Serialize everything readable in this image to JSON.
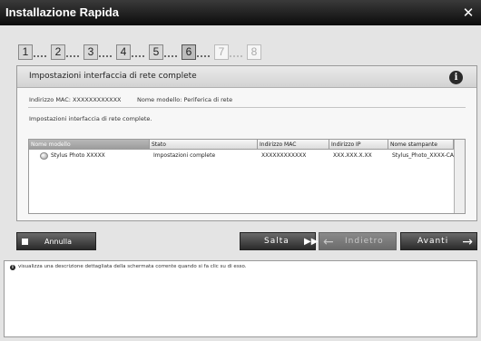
{
  "window": {
    "title": "Installazione Rapida",
    "close_icon": "close-icon"
  },
  "steps": [
    {
      "label": "1",
      "state": "done"
    },
    {
      "label": "2",
      "state": "done"
    },
    {
      "label": "3",
      "state": "done"
    },
    {
      "label": "4",
      "state": "done"
    },
    {
      "label": "5",
      "state": "done"
    },
    {
      "label": "6",
      "state": "current"
    },
    {
      "label": "7",
      "state": "disabled"
    },
    {
      "label": "8",
      "state": "disabled"
    }
  ],
  "panel": {
    "heading": "Impostazioni interfaccia di rete complete",
    "info_icon": "info-icon",
    "mac_label": "Indirizzo MAC: XXXXXXXXXXXX",
    "model_label": "Nome modello: Periferica di rete",
    "status_text": "Impostazioni interfaccia di rete complete."
  },
  "table": {
    "columns": [
      "Nome modello",
      "Stato",
      "Indirizzo MAC",
      "Indirizzo IP",
      "Nome stampante"
    ],
    "rows": [
      [
        "Stylus Photo XXXXX",
        "Impostazioni complete",
        "XXXXXXXXXXXX",
        "XXX.XXX.X.XX",
        "Stylus_Photo_XXXX-CA"
      ]
    ]
  },
  "buttons": {
    "cancel": "Annulla",
    "skip": "Salta",
    "back": "Indietro",
    "next": "Avanti"
  },
  "description": "visualizza una descrizione dettagliata della schermata corrente quando si fa clic su di esso.",
  "colors": {
    "titlebar": "#1a1a1a",
    "button": "#3c3c3c",
    "button_disabled": "#7a7a7a"
  }
}
